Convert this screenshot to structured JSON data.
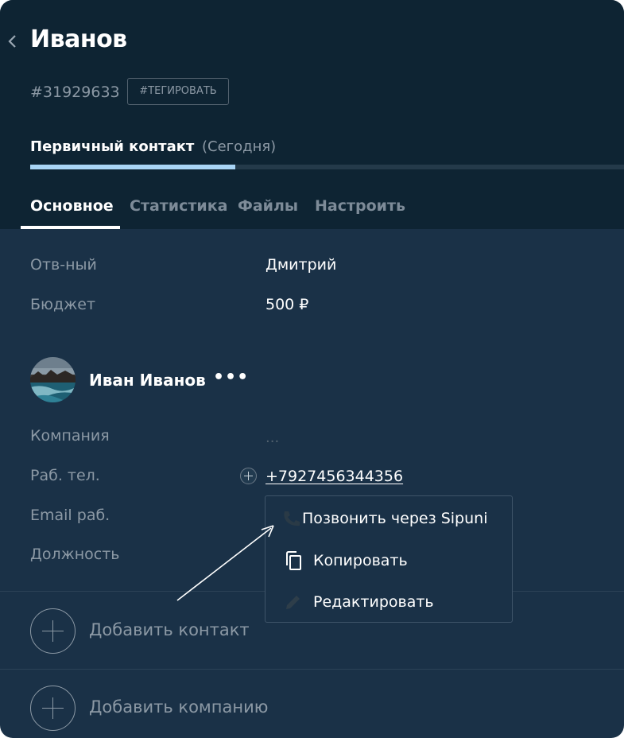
{
  "header": {
    "title": "Иванов",
    "lead_id": "#31929633",
    "tag_button": "#ТЕГИРОВАТЬ",
    "stage": {
      "name": "Первичный контакт",
      "date": "(Сегодня)",
      "progress_fraction": 0.345
    },
    "tabs": [
      {
        "label": "Основное",
        "active": true
      },
      {
        "label": "Статистика",
        "active": false
      },
      {
        "label": "Файлы",
        "active": false
      },
      {
        "label": "Настроить",
        "active": false
      }
    ]
  },
  "lead_fields": [
    {
      "label": "Отв-ный",
      "value": "Дмитрий"
    },
    {
      "label": "Бюджет",
      "value": "500 ₽"
    }
  ],
  "contact": {
    "name": "Иван Иванов",
    "more": "•••",
    "fields": [
      {
        "label": "Компания",
        "value": "..."
      },
      {
        "label": "Раб. тел.",
        "value": "+7927456344356"
      },
      {
        "label": "Email раб.",
        "value": ""
      },
      {
        "label": "Должность",
        "value": ""
      }
    ]
  },
  "phone_menu": {
    "items": [
      {
        "label": "Позвонить через Sipuni",
        "icon": "phone-icon"
      },
      {
        "label": "Копировать",
        "icon": "copy-icon"
      },
      {
        "label": "Редактировать",
        "icon": "pencil-icon"
      }
    ]
  },
  "actions": {
    "add_contact": "Добавить контакт",
    "add_company": "Добавить компанию"
  },
  "colors": {
    "header_bg": "#0e2433",
    "body_bg": "#1a3147",
    "progress_fill": "#a8d4f5",
    "muted_text": "#8c99a5"
  }
}
